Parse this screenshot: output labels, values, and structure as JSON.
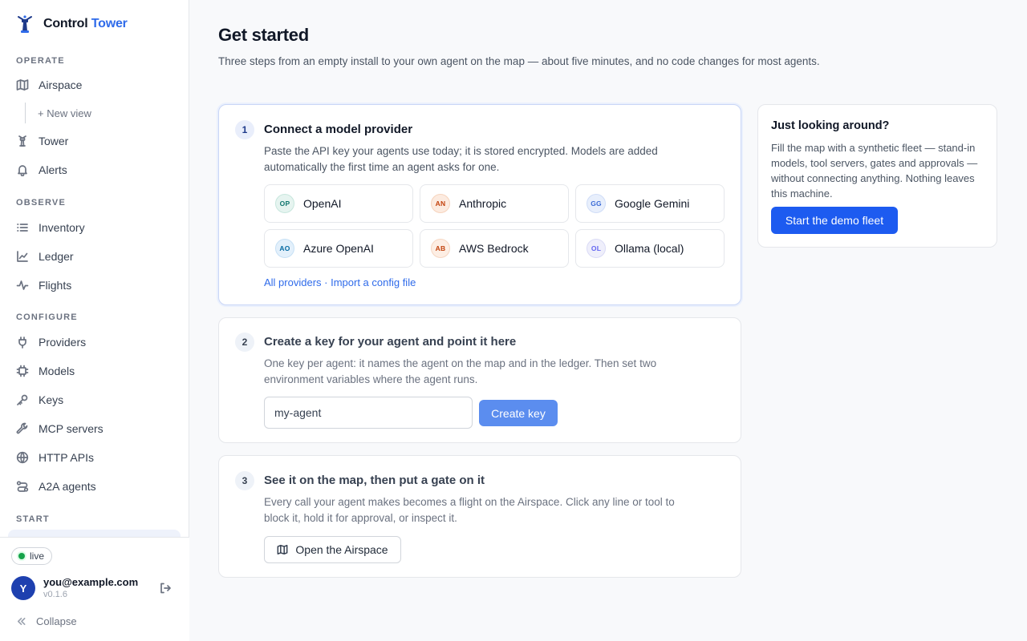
{
  "brand": {
    "name": "Control",
    "accent": "Tower",
    "accent_color": "#2f6bea"
  },
  "sidebar": {
    "sections": {
      "operate": "Operate",
      "observe": "Observe",
      "configure": "Configure",
      "start": "Start"
    },
    "items": {
      "airspace": {
        "label": "Airspace",
        "icon": "map-icon"
      },
      "new_view": {
        "label": "+ New view"
      },
      "tower": {
        "label": "Tower",
        "icon": "tower-icon"
      },
      "alerts": {
        "label": "Alerts",
        "icon": "bell-icon"
      },
      "inventory": {
        "label": "Inventory",
        "icon": "list-icon"
      },
      "ledger": {
        "label": "Ledger",
        "icon": "line-chart-icon"
      },
      "flights": {
        "label": "Flights",
        "icon": "pulse-icon"
      },
      "providers": {
        "label": "Providers",
        "icon": "plug-icon"
      },
      "models": {
        "label": "Models",
        "icon": "chip-icon"
      },
      "keys": {
        "label": "Keys",
        "icon": "key-icon"
      },
      "mcp_servers": {
        "label": "MCP servers",
        "icon": "wrench-icon"
      },
      "http_apis": {
        "label": "HTTP APIs",
        "icon": "globe-icon"
      },
      "a2a_agents": {
        "label": "A2A agents",
        "icon": "route-icon"
      }
    },
    "footer": {
      "status": "live",
      "status_color": "#16a34a",
      "user_initial": "Y",
      "user_email": "you@example.com",
      "version": "v0.1.6",
      "collapse_label": "Collapse"
    }
  },
  "main": {
    "title": "Get started",
    "subtitle": "Three steps from an empty install to your own agent on the map — about five minutes, and no code changes for most agents.",
    "steps": [
      {
        "number": "1",
        "title": "Connect a model provider",
        "description": "Paste the API key your agents use today; it is stored encrypted. Models are added automatically the first time an agent asks for one.",
        "providers": [
          {
            "badge": "OP",
            "name": "OpenAI",
            "bg": "#e6f4f0",
            "fg": "#0f766e"
          },
          {
            "badge": "AN",
            "name": "Anthropic",
            "bg": "#fcebe0",
            "fg": "#c2410c"
          },
          {
            "badge": "GG",
            "name": "Google Gemini",
            "bg": "#e8effc",
            "fg": "#3b6bd6"
          },
          {
            "badge": "AO",
            "name": "Azure OpenAI",
            "bg": "#e3f0fb",
            "fg": "#0369a1"
          },
          {
            "badge": "AB",
            "name": "AWS Bedrock",
            "bg": "#fdeee4",
            "fg": "#c2410c"
          },
          {
            "badge": "OL",
            "name": "Ollama (local)",
            "bg": "#efeffb",
            "fg": "#6366f1"
          }
        ],
        "link_all": "All providers",
        "link_separator": " · ",
        "link_import": "Import a config file"
      },
      {
        "number": "2",
        "title": "Create a key for your agent and point it here",
        "description": "One key per agent: it names the agent on the map and in the ledger. Then set two environment variables where the agent runs.",
        "input_value": "my-agent",
        "button_label": "Create key"
      },
      {
        "number": "3",
        "title": "See it on the map, then put a gate on it",
        "description": "Every call your agent makes becomes a flight on the Airspace. Click any line or tool to block it, hold it for approval, or inspect it.",
        "button_label": "Open the Airspace"
      }
    ],
    "demo": {
      "title": "Just looking around?",
      "description": "Fill the map with a synthetic fleet — stand-in models, tool servers, gates and approvals — without connecting anything. Nothing leaves this machine.",
      "button_label": "Start the demo fleet",
      "button_color": "#1d5bf0"
    }
  }
}
